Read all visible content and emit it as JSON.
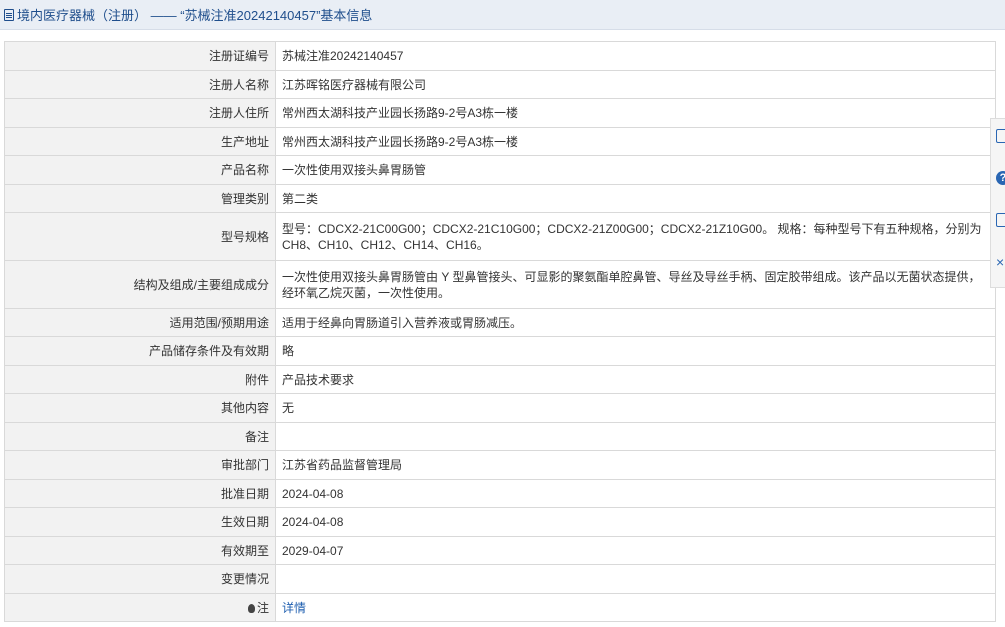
{
  "header": {
    "title": "境内医疗器械（注册） —— “苏械注准20242140457”基本信息"
  },
  "rows": [
    {
      "label": "注册证编号",
      "value": "苏械注准20242140457"
    },
    {
      "label": "注册人名称",
      "value": "江苏晖铭医疗器械有限公司"
    },
    {
      "label": "注册人住所",
      "value": "常州西太湖科技产业园长扬路9-2号A3栋一楼"
    },
    {
      "label": "生产地址",
      "value": "常州西太湖科技产业园长扬路9-2号A3栋一楼"
    },
    {
      "label": "产品名称",
      "value": "一次性使用双接头鼻胃肠管"
    },
    {
      "label": "管理类别",
      "value": "第二类"
    },
    {
      "label": "型号规格",
      "value": "型号：CDCX2-21C00G00；CDCX2-21C10G00；CDCX2-21Z00G00；CDCX2-21Z10G00。 规格：每种型号下有五种规格，分别为CH8、CH10、CH12、CH14、CH16。"
    },
    {
      "label": "结构及组成/主要组成成分",
      "value": "一次性使用双接头鼻胃肠管由 Y 型鼻管接头、可显影的聚氨酯单腔鼻管、导丝及导丝手柄、固定胶带组成。该产品以无菌状态提供，经环氧乙烷灭菌，一次性使用。"
    },
    {
      "label": "适用范围/预期用途",
      "value": "适用于经鼻向胃肠道引入营养液或胃肠减压。"
    },
    {
      "label": "产品储存条件及有效期",
      "value": "略"
    },
    {
      "label": "附件",
      "value": "产品技术要求"
    },
    {
      "label": "其他内容",
      "value": "无"
    },
    {
      "label": "备注",
      "value": ""
    },
    {
      "label": "审批部门",
      "value": "江苏省药品监督管理局"
    },
    {
      "label": "批准日期",
      "value": "2024-04-08"
    },
    {
      "label": "生效日期",
      "value": "2024-04-08"
    },
    {
      "label": "有效期至",
      "value": "2029-04-07"
    },
    {
      "label": "变更情况",
      "value": ""
    }
  ],
  "note_row": {
    "label": "注",
    "link": "详情"
  },
  "side_tools": {
    "help_glyph": "?",
    "close_glyph": "×"
  }
}
